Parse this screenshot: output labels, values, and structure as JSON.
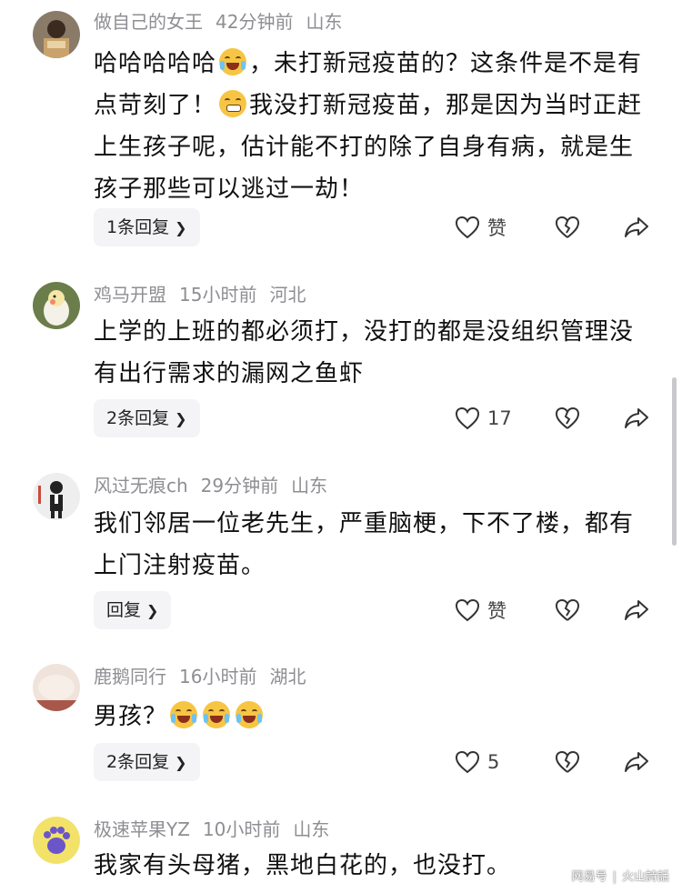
{
  "comments": [
    {
      "username": "做自己的女王",
      "time": "42分钟前",
      "location": "山东",
      "text_parts": [
        "哈哈哈哈哈",
        "，未打新冠疫苗的？这条件是不是有点苛刻了！",
        "我没打新冠疫苗，那是因为当时正赶上生孩子呢，估计能不打的除了自身有病，就是生孩子那些可以逃过一劫！"
      ],
      "emojis": [
        "crying-laughing-emoji",
        "grinning-emoji"
      ],
      "reply_label": "1条回复",
      "like_label": "赞",
      "avatar_color": "#7a6a5a"
    },
    {
      "username": "鸡马开盟",
      "time": "15小时前",
      "location": "河北",
      "text": "上学的上班的都必须打，没打的都是没组织管理没有出行需求的漏网之鱼虾",
      "reply_label": "2条回复",
      "like_label": "17",
      "avatar_color": "#8fa06a"
    },
    {
      "username": "风过无痕ch",
      "time": "29分钟前",
      "location": "山东",
      "text": "我们邻居一位老先生，严重脑梗，下不了楼，都有上门注射疫苗。",
      "reply_label": "回复",
      "like_label": "赞",
      "avatar_color": "#dcdcdc"
    },
    {
      "username": "鹿鹅同行",
      "time": "16小时前",
      "location": "湖北",
      "text": "男孩？",
      "emojis": [
        "crying-laughing-emoji",
        "crying-laughing-emoji",
        "crying-laughing-emoji"
      ],
      "reply_label": "2条回复",
      "like_label": "5",
      "avatar_color": "#c98a7a"
    },
    {
      "username": "极速苹果YZ",
      "time": "10小时前",
      "location": "山东",
      "text": "我家有头母猪，黑地白花的，也没打。",
      "avatar_color": "#f4e36a"
    }
  ],
  "watermark": {
    "left": "网易号",
    "right": "火山詩話"
  },
  "colors": {
    "meta_text": "#8e8e93",
    "reply_button_bg": "#f4f4f6"
  }
}
